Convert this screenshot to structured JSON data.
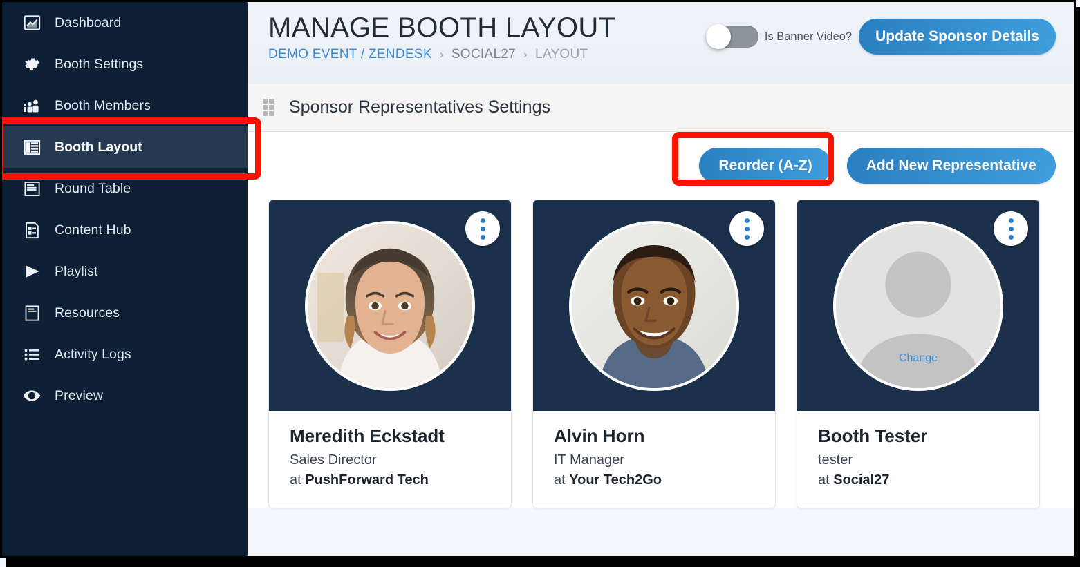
{
  "sidebar": {
    "items": [
      {
        "label": "Dashboard",
        "icon": "chart-line-icon",
        "active": false
      },
      {
        "label": "Booth Settings",
        "icon": "gear-icon",
        "active": false
      },
      {
        "label": "Booth Members",
        "icon": "people-group-icon",
        "active": false
      },
      {
        "label": "Booth Layout",
        "icon": "layout-list-icon",
        "active": true
      },
      {
        "label": "Round Table",
        "icon": "table-card-icon",
        "active": false
      },
      {
        "label": "Content Hub",
        "icon": "document-grid-icon",
        "active": false
      },
      {
        "label": "Playlist",
        "icon": "play-triangle-icon",
        "active": false
      },
      {
        "label": "Resources",
        "icon": "resources-icon",
        "active": false
      },
      {
        "label": "Activity Logs",
        "icon": "bullet-list-icon",
        "active": false
      },
      {
        "label": "Preview",
        "icon": "eye-icon",
        "active": false
      }
    ]
  },
  "header": {
    "title": "MANAGE BOOTH LAYOUT",
    "breadcrumb": {
      "root": "DEMO EVENT / ZENDESK",
      "sep1": "›",
      "middle": "SOCIAL27",
      "sep2": "›",
      "current": "LAYOUT"
    },
    "banner_toggle_label": "Is Banner Video?",
    "banner_toggle_state": "off",
    "update_sponsor_label": "Update Sponsor Details"
  },
  "section": {
    "title": "Sponsor Representatives Settings",
    "reorder_label": "Reorder (A-Z)",
    "add_new_label": "Add New Representative"
  },
  "representatives": [
    {
      "name": "Meredith Eckstadt",
      "role": "Sales Director",
      "at_prefix": "at ",
      "company": "PushForward Tech",
      "avatar": "photo-woman",
      "change_label": ""
    },
    {
      "name": "Alvin Horn",
      "role": "IT Manager",
      "at_prefix": "at ",
      "company": "Your Tech2Go",
      "avatar": "photo-man",
      "change_label": ""
    },
    {
      "name": "Booth Tester",
      "role": "tester",
      "at_prefix": "at ",
      "company": "Social27",
      "avatar": "placeholder",
      "change_label": "Change"
    }
  ],
  "colors": {
    "sidebar_bg": "#0d2036",
    "sidebar_active_bg": "#24384f",
    "card_photo_bg": "#1b314b",
    "accent_blue": "#2b7fc6",
    "link_blue": "#3a8cd8",
    "page_bg": "#f4f8fc",
    "annotation_red": "#fb1100"
  }
}
